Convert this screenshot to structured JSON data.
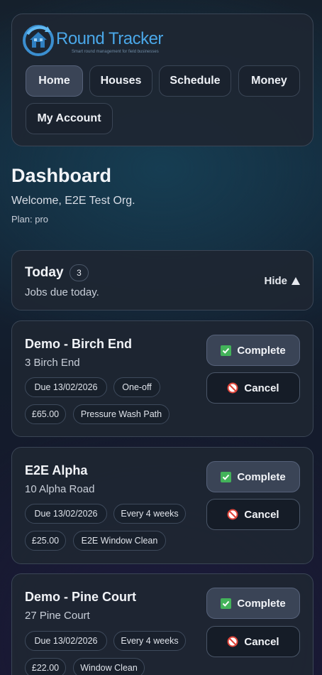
{
  "app": {
    "name": "Round Tracker",
    "tagline": "Smart round management for field businesses"
  },
  "nav": {
    "items": [
      {
        "label": "Home",
        "active": true
      },
      {
        "label": "Houses",
        "active": false
      },
      {
        "label": "Schedule",
        "active": false
      },
      {
        "label": "Money",
        "active": false
      },
      {
        "label": "My Account",
        "active": false
      }
    ]
  },
  "dashboard": {
    "title": "Dashboard",
    "welcome": "Welcome, E2E Test Org.",
    "plan": "Plan: pro"
  },
  "today": {
    "title": "Today",
    "count": "3",
    "subtitle": "Jobs due today.",
    "hide_label": "Hide"
  },
  "jobs": [
    {
      "name": "Demo - Birch End",
      "address": "3 Birch End",
      "due": "Due 13/02/2026",
      "frequency": "One-off",
      "price": "£65.00",
      "service": "Pressure Wash Path",
      "complete_label": "Complete",
      "cancel_label": "Cancel"
    },
    {
      "name": "E2E Alpha",
      "address": "10 Alpha Road",
      "due": "Due 13/02/2026",
      "frequency": "Every 4 weeks",
      "price": "£25.00",
      "service": "E2E Window Clean",
      "complete_label": "Complete",
      "cancel_label": "Cancel"
    },
    {
      "name": "Demo - Pine Court",
      "address": "27 Pine Court",
      "due": "Due 13/02/2026",
      "frequency": "Every 4 weeks",
      "price": "£22.00",
      "service": "Window Clean",
      "complete_label": "Complete",
      "cancel_label": "Cancel"
    }
  ],
  "colors": {
    "brand": "#4aa7e8",
    "complete_icon": "#43b35a",
    "cancel_icon": "#e0453a"
  },
  "icons": {
    "complete": "check-box-icon",
    "cancel": "no-entry-icon",
    "hide": "triangle-up-icon",
    "logo": "house-logo-icon"
  }
}
